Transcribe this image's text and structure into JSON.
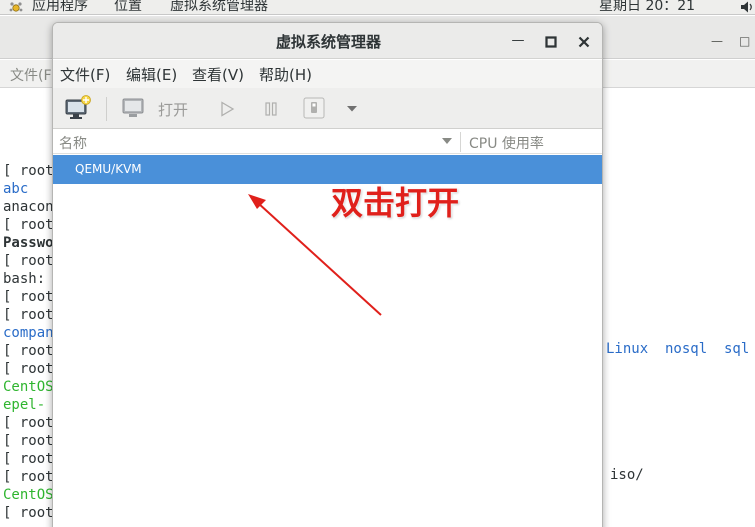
{
  "topbar": {
    "applications": "应用程序",
    "places": "位置",
    "active_app": "虚拟系统管理器",
    "clock": "星期日 20：21"
  },
  "terminal": {
    "menu_file_partial": "文件(F",
    "lines": [
      {
        "text": "[ root@",
        "color": "#2e3436",
        "bold": false
      },
      {
        "text": "abc",
        "color": "#2a6cc8",
        "bold": false
      },
      {
        "text": "anacon",
        "color": "#2e3436",
        "bold": false
      },
      {
        "text": "[ root@",
        "color": "#2e3436",
        "bold": false
      },
      {
        "text": "Passwo",
        "color": "#2e3436",
        "bold": true
      },
      {
        "text": "[ root@",
        "color": "#2e3436",
        "bold": false
      },
      {
        "text": "bash: ",
        "color": "#2e3436",
        "bold": false
      },
      {
        "text": "[ root@",
        "color": "#2e3436",
        "bold": false
      },
      {
        "text": "[ root@",
        "color": "#2e3436",
        "bold": false
      },
      {
        "text": "compan",
        "color": "#2a6cc8",
        "bold": false
      },
      {
        "text": "[ root@",
        "color": "#2e3436",
        "bold": false
      },
      {
        "text": "[ root@",
        "color": "#2e3436",
        "bold": false
      },
      {
        "text": "CentOS",
        "color": "#2fb52f",
        "bold": false
      },
      {
        "text": "epel- r",
        "color": "#2fb52f",
        "bold": false
      },
      {
        "text": "[ root@",
        "color": "#2e3436",
        "bold": false
      },
      {
        "text": "[ root@",
        "color": "#2e3436",
        "bold": false
      },
      {
        "text": "[ root@",
        "color": "#2e3436",
        "bold": false
      },
      {
        "text": "[ root@",
        "color": "#2e3436",
        "bold": false
      },
      {
        "text": "CentOS",
        "color": "#2fb52f",
        "bold": false
      },
      {
        "text": "[ root@",
        "color": "#2e3436",
        "bold": false
      }
    ],
    "right_dirs": "Linux  nosql  sql",
    "right_iso": "iso/"
  },
  "window": {
    "title": "虚拟系统管理器",
    "menus": [
      "文件(F)",
      "编辑(E)",
      "查看(V)",
      "帮助(H)"
    ],
    "toolbar": {
      "open_label": "打开"
    },
    "columns": {
      "name": "名称",
      "cpu": "CPU 使用率"
    },
    "connections": [
      {
        "name": "QEMU/KVM",
        "selected": true
      }
    ]
  },
  "annotation": {
    "text": "双击打开",
    "color": "#e0201b"
  },
  "colors": {
    "selection": "#4a90d9",
    "term_blue": "#2a6cc8",
    "term_green": "#2fb52f"
  }
}
